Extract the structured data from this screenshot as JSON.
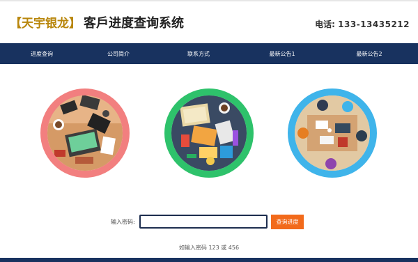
{
  "header": {
    "brand_open": "【",
    "brand_name": "天宇银龙",
    "brand_close": "】",
    "title": "客戶进度查询系统",
    "phone_label": "电话:",
    "phone_number": "133-13435212"
  },
  "nav": {
    "items": [
      {
        "label": "进度查询"
      },
      {
        "label": "公司简介"
      },
      {
        "label": "联系方式"
      },
      {
        "label": "最新公告1"
      },
      {
        "label": "最新公告2"
      }
    ]
  },
  "illustrations": [
    {
      "name": "workspace-laptop-red",
      "ring_color": "#f27f7f",
      "bg": "#d59a66"
    },
    {
      "name": "workspace-desk-green",
      "ring_color": "#2ec26b",
      "bg": "#3a4a63"
    },
    {
      "name": "workspace-team-blue",
      "ring_color": "#3fb4ea",
      "bg": "#e2c9a3"
    }
  ],
  "search": {
    "label": "输入密码:",
    "value": "",
    "placeholder": "",
    "button_label": "查询进度"
  },
  "hint": "如输入密码 123 或 456",
  "colors": {
    "nav_bg": "#18325f",
    "brand_accent": "#b8860b",
    "button_bg": "#f26a1b"
  }
}
